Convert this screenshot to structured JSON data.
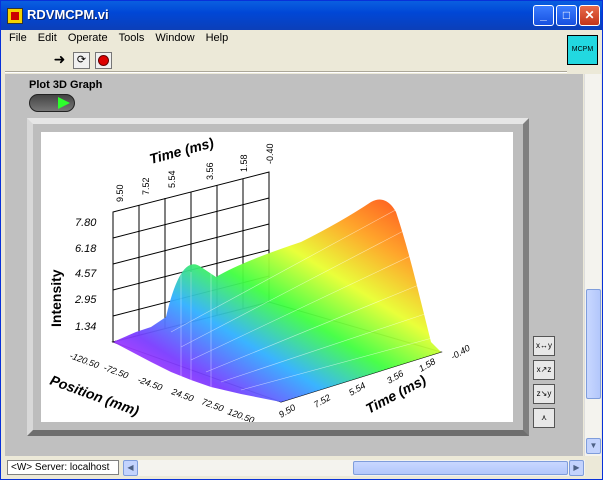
{
  "window": {
    "title": "RDVMCPM.vi"
  },
  "menu": {
    "items": [
      "File",
      "Edit",
      "Operate",
      "Tools",
      "Window",
      "Help"
    ]
  },
  "mcpm": {
    "label": "MCPM"
  },
  "panel": {
    "plot_label": "Plot 3D Graph"
  },
  "graph": {
    "time_axis_top_label": "Time (ms)",
    "time_ticks_top": [
      "9.50",
      "7.52",
      "5.54",
      "3.56",
      "1.58",
      "-0.40"
    ],
    "intensity_label": "Intensity",
    "intensity_ticks": [
      "7.80",
      "6.18",
      "4.57",
      "2.95",
      "1.34"
    ],
    "position_label": "Position (mm)",
    "position_ticks": [
      "-120.50",
      "-72.50",
      "-24.50",
      "24.50",
      "72.50",
      "120.50"
    ],
    "time_axis_bottom_label": "Time (ms)",
    "time_ticks_bottom": [
      "-0.40",
      "1.58",
      "3.56",
      "5.54",
      "7.52",
      "9.50"
    ]
  },
  "status": {
    "server": "<W> Server: localhost"
  }
}
